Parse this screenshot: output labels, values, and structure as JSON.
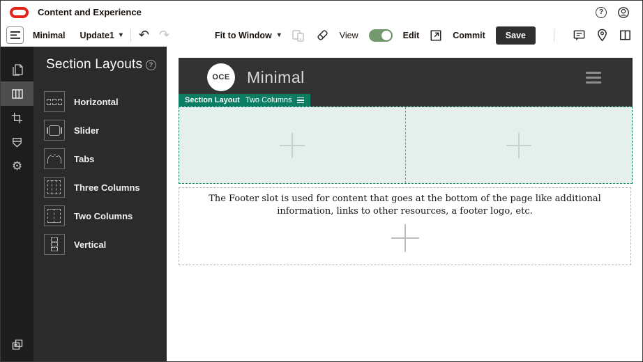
{
  "topbar": {
    "brand": "Content and Experience"
  },
  "toolbar": {
    "site_name": "Minimal",
    "update_label": "Update1",
    "zoom_label": "Fit to Window",
    "view_label": "View",
    "edit_label": "Edit",
    "commit_label": "Commit",
    "save_label": "Save"
  },
  "panel": {
    "title": "Section Layouts",
    "items": [
      {
        "label": "Horizontal",
        "icon": "horizontal-layout-icon"
      },
      {
        "label": "Slider",
        "icon": "slider-layout-icon"
      },
      {
        "label": "Tabs",
        "icon": "tabs-layout-icon"
      },
      {
        "label": "Three Columns",
        "icon": "three-columns-layout-icon"
      },
      {
        "label": "Two Columns",
        "icon": "two-columns-layout-icon"
      },
      {
        "label": "Vertical",
        "icon": "vertical-layout-icon"
      }
    ]
  },
  "rail": {
    "items": [
      "pages-icon",
      "section-layouts-icon",
      "crop-icon",
      "theme-icon",
      "settings-icon"
    ],
    "selected": "section-layouts-icon",
    "bottom_item": "background-icon"
  },
  "canvas": {
    "logo_text": "OCE",
    "site_title": "Minimal",
    "slot_tag_type": "Section Layout",
    "slot_tag_name": "Two Columns",
    "footer_text": "The Footer slot is used for content that goes at the bottom of the page like additional information, links to other resources, a footer logo, etc."
  },
  "icons": {
    "caret": "▾",
    "undo": "↶",
    "redo": "↷",
    "gear": "⚙",
    "help": "?"
  },
  "colors": {
    "oracle_red": "#e2231a",
    "accent_green": "#0b7d62",
    "toggle_green": "#75996e",
    "slot_mint": "#e5f0ec",
    "header_dark": "#333333",
    "rail_dark": "#1d1d1d",
    "panel_dark": "#2b2b2b",
    "save_button_dark": "#2f2f2f"
  }
}
